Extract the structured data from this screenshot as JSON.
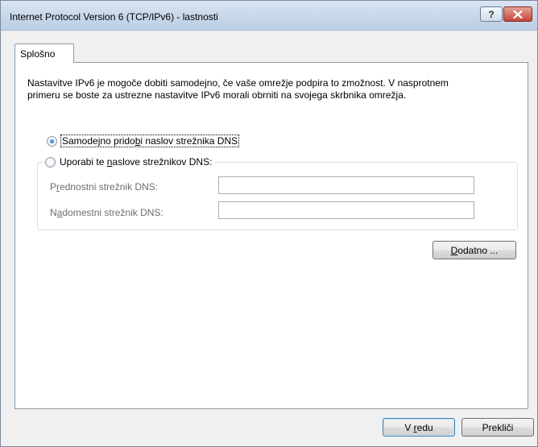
{
  "window": {
    "title": "Internet Protocol Version 6 (TCP/IPv6) - lastnosti",
    "help_label": "?",
    "close_icon": "close-icon"
  },
  "tabs": [
    {
      "label": "Splošno",
      "selected": true
    }
  ],
  "description": {
    "line1": "Nastavitve IPv6 je mogoče dobiti samodejno, če vaše omrežje podpira to zmožnost. V nasprotnem",
    "line2": "primeru se boste za ustrezne nastavitve IPv6 morali obrniti na svojega skrbnika omrežja."
  },
  "dns": {
    "auto_option": {
      "before": "Samodejno prido",
      "accel": "b",
      "after": "i naslov strežnika DNS",
      "selected": true
    },
    "manual_option": {
      "before": "Uporabi te ",
      "accel": "n",
      "after": "aslove strežnikov DNS:",
      "selected": false
    },
    "preferred": {
      "before": "P",
      "accel": "r",
      "after": "ednostni strežnik DNS:",
      "value": ""
    },
    "alternate": {
      "before": "N",
      "accel": "a",
      "after": "domestni strežnik DNS:",
      "value": ""
    }
  },
  "buttons": {
    "advanced": {
      "before": "",
      "accel": "D",
      "after": "odatno ..."
    },
    "ok": {
      "before": "V ",
      "accel": "r",
      "after": "edu"
    },
    "cancel": "Prekliči"
  },
  "colors": {
    "titlebar": "#c9d8ea",
    "close_button": "#c6463a",
    "radio_selected": "#1a5bb5"
  }
}
